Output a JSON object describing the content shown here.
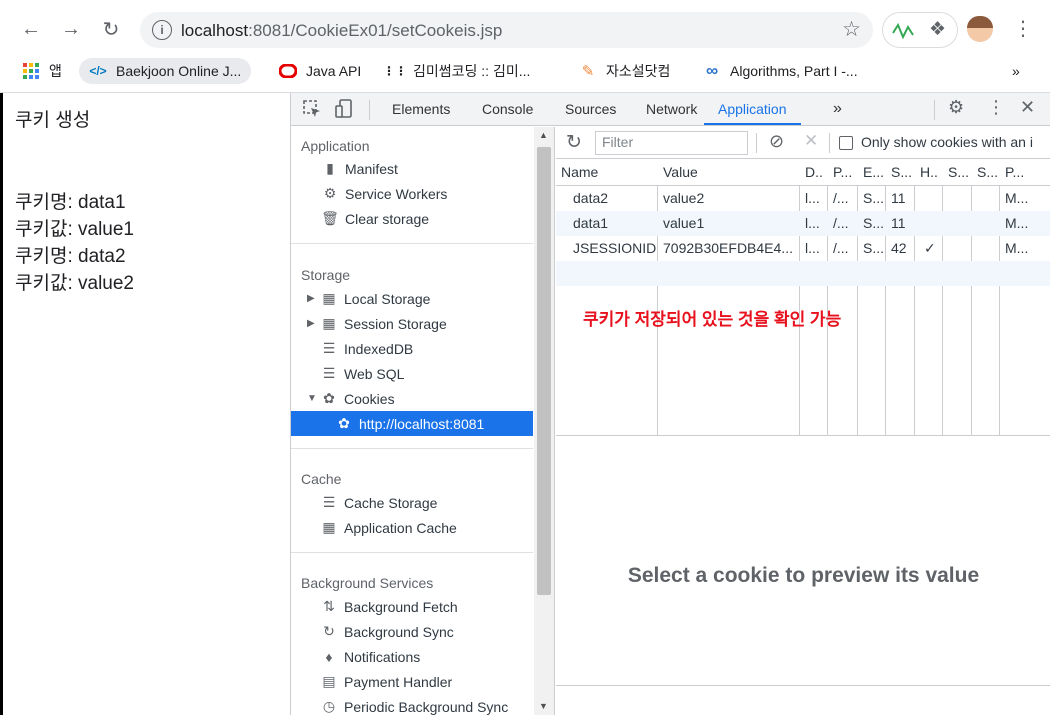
{
  "browser": {
    "url_host": "localhost",
    "url_rest": ":8081/CookieEx01/setCookeis.jsp",
    "bookmarks": [
      {
        "label": "앱",
        "icon": "apps-grid-icon"
      },
      {
        "label": "Baekjoon Online J...",
        "icon": "code-icon"
      },
      {
        "label": "Java API",
        "icon": "oracle-icon"
      },
      {
        "label": "김미썸코딩 :: 김미...",
        "icon": "dots-icon"
      },
      {
        "label": "자소설닷컴",
        "icon": "pencil-icon"
      },
      {
        "label": "Algorithms, Part I -...",
        "icon": "infinity-icon"
      }
    ],
    "more_bookmarks": "»"
  },
  "page": {
    "heading": "쿠키 생성",
    "lines": [
      "쿠키명: data1",
      "쿠키값: value1",
      "쿠키명: data2",
      "쿠키값: value2"
    ]
  },
  "devtools": {
    "tabs": [
      "Elements",
      "Console",
      "Sources",
      "Network",
      "Application"
    ],
    "active_tab": "Application",
    "more_tabs": "»",
    "sidebar": {
      "sections": [
        {
          "title": "Application",
          "items": [
            "Manifest",
            "Service Workers",
            "Clear storage"
          ]
        },
        {
          "title": "Storage",
          "items": [
            "Local Storage",
            "Session Storage",
            "IndexedDB",
            "Web SQL",
            "Cookies",
            "http://localhost:8081"
          ]
        },
        {
          "title": "Cache",
          "items": [
            "Cache Storage",
            "Application Cache"
          ]
        },
        {
          "title": "Background Services",
          "items": [
            "Background Fetch",
            "Background Sync",
            "Notifications",
            "Payment Handler",
            "Periodic Background Sync"
          ]
        }
      ]
    },
    "filter_placeholder": "Filter",
    "only_issues_label": "Only show cookies with an i",
    "columns": [
      "Name",
      "Value",
      "D..",
      "P...",
      "E...",
      "S...",
      "H..",
      "S...",
      "S...",
      "P..."
    ],
    "rows": [
      [
        "data2",
        "value2",
        "l...",
        "/...",
        "S...",
        "11",
        "",
        "",
        "",
        "M..."
      ],
      [
        "data1",
        "value1",
        "l...",
        "/...",
        "S...",
        "11",
        "",
        "",
        "",
        "M..."
      ],
      [
        "JSESSIONID",
        "7092B30EFDB4E4...",
        "l...",
        "/...",
        "S...",
        "42",
        "✓",
        "",
        "",
        "M..."
      ]
    ],
    "annotation": "쿠키가 저장되어 있는 것을 확인 가능",
    "preview_text": "Select a cookie to preview its value"
  }
}
